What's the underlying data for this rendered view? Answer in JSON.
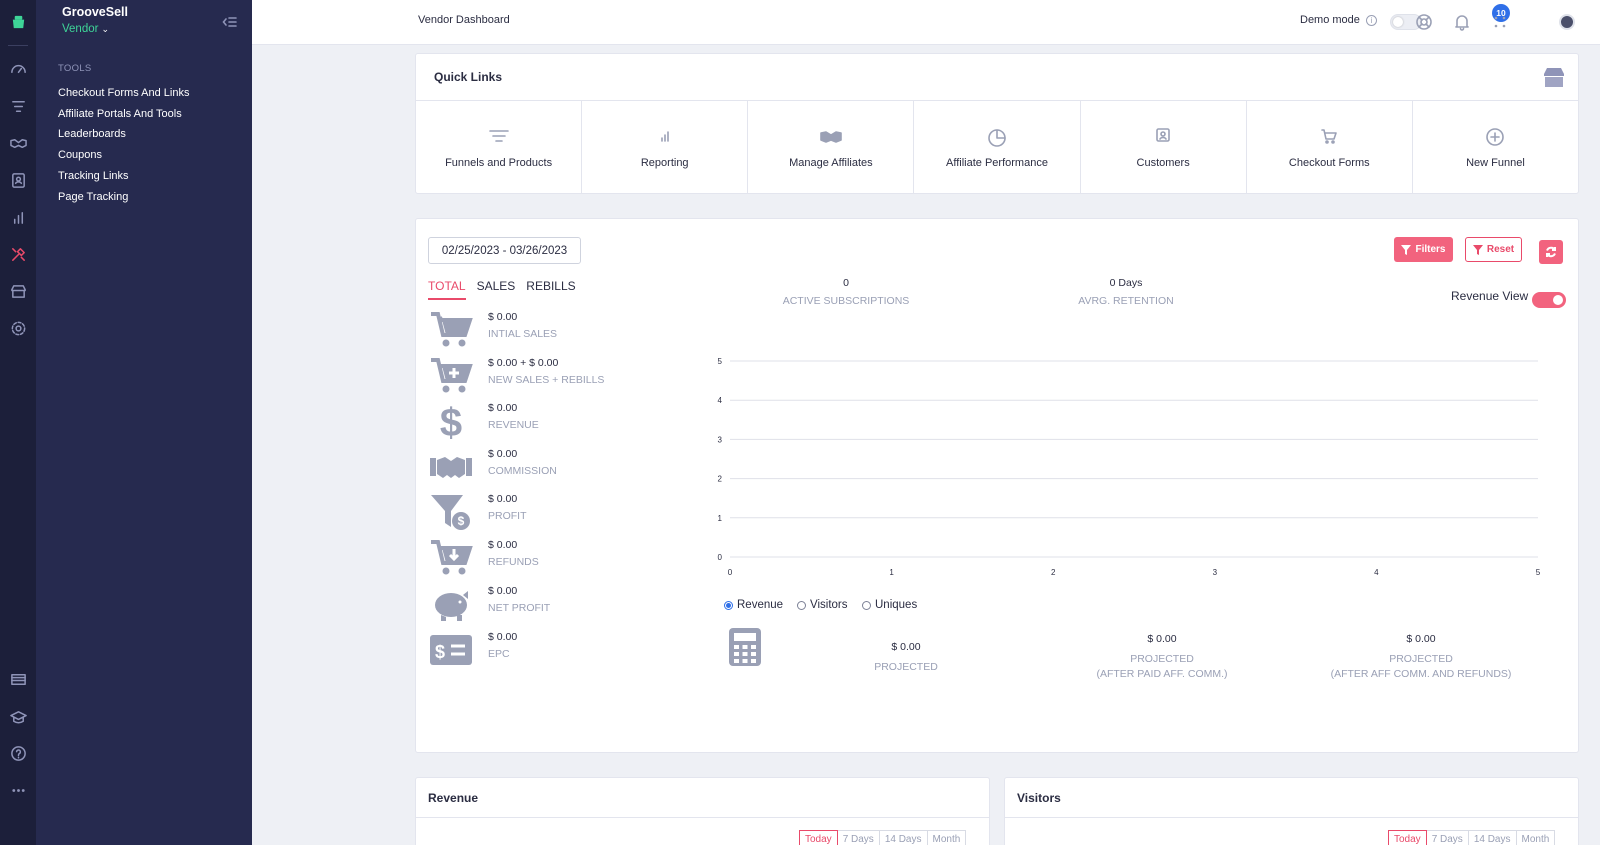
{
  "app": {
    "brand": "GrooveSell",
    "role": "Vendor"
  },
  "sidebar": {
    "heading": "TOOLS",
    "items": [
      {
        "label": "Checkout Forms And Links"
      },
      {
        "label": "Affiliate Portals And Tools"
      },
      {
        "label": "Leaderboards"
      },
      {
        "label": "Coupons"
      },
      {
        "label": "Tracking Links"
      },
      {
        "label": "Page Tracking"
      }
    ]
  },
  "topbar": {
    "title": "Vendor Dashboard",
    "demo_label": "Demo mode",
    "notification_count": "10"
  },
  "quick_links": {
    "title": "Quick Links",
    "items": [
      {
        "label": "Funnels and Products",
        "icon": "funnel-icon"
      },
      {
        "label": "Reporting",
        "icon": "bar-chart-icon"
      },
      {
        "label": "Manage Affiliates",
        "icon": "handshake-icon"
      },
      {
        "label": "Affiliate Performance",
        "icon": "pie-chart-icon"
      },
      {
        "label": "Customers",
        "icon": "customer-icon"
      },
      {
        "label": "Checkout Forms",
        "icon": "cart-icon"
      },
      {
        "label": "New Funnel",
        "icon": "plus-circle-icon"
      }
    ]
  },
  "dashboard": {
    "date_range": "02/25/2023 - 03/26/2023",
    "filters_label": "Filters",
    "reset_label": "Reset",
    "tabs": [
      "TOTAL",
      "SALES",
      "REBILLS"
    ],
    "active_tab": "TOTAL",
    "metrics": [
      {
        "value": "$ 0.00",
        "label": "INTIAL SALES",
        "icon": "cart-icon"
      },
      {
        "value": "$ 0.00 + $ 0.00",
        "label": "NEW SALES + REBILLS",
        "icon": "cart-plus-icon"
      },
      {
        "value": "$ 0.00",
        "label": "REVENUE",
        "icon": "dollar-icon"
      },
      {
        "value": "$ 0.00",
        "label": "COMMISSION",
        "icon": "handshake-icon"
      },
      {
        "value": "$ 0.00",
        "label": "PROFIT",
        "icon": "funnel-dollar-icon"
      },
      {
        "value": "$ 0.00",
        "label": "REFUNDS",
        "icon": "cart-arrow-down-icon"
      },
      {
        "value": "$ 0.00",
        "label": "NET PROFIT",
        "icon": "piggy-bank-icon"
      },
      {
        "value": "$ 0.00",
        "label": "EPC",
        "icon": "money-bill-icon"
      }
    ],
    "active_subscriptions": {
      "value": "0",
      "label": "ACTIVE SUBSCRIPTIONS"
    },
    "avg_retention": {
      "value": "0 Days",
      "label": "AVRG. RETENTION"
    },
    "revenue_view_label": "Revenue View",
    "radios": [
      {
        "label": "Revenue",
        "checked": true
      },
      {
        "label": "Visitors",
        "checked": false
      },
      {
        "label": "Uniques",
        "checked": false
      }
    ],
    "projections": [
      {
        "value": "$ 0.00",
        "label": "PROJECTED",
        "label2": ""
      },
      {
        "value": "$ 0.00",
        "label": "PROJECTED",
        "label2": "(AFTER PAID AFF. COMM.)"
      },
      {
        "value": "$ 0.00",
        "label": "PROJECTED",
        "label2": "(AFTER AFF COMM. AND REFUNDS)"
      }
    ]
  },
  "chart_data": {
    "type": "line",
    "title": "",
    "xlabel": "",
    "ylabel": "",
    "x_ticks": [
      "0",
      "1",
      "2",
      "3",
      "4",
      "5"
    ],
    "y_ticks": [
      "0",
      "1",
      "2",
      "3",
      "4",
      "5"
    ],
    "xlim": [
      0,
      5
    ],
    "ylim": [
      0,
      5
    ],
    "grid": true,
    "series": []
  },
  "revenue_panel": {
    "title": "Revenue",
    "ranges": [
      "Today",
      "7 Days",
      "14 Days",
      "Month"
    ]
  },
  "visitors_panel": {
    "title": "Visitors",
    "ranges": [
      "Today",
      "7 Days",
      "14 Days",
      "Month"
    ]
  },
  "colors": {
    "accent": "#f2637e",
    "brand_green": "#3ed598",
    "sidebar": "#262a4f",
    "rail": "#1c1f3a",
    "link_blue": "#2f6fe8"
  }
}
